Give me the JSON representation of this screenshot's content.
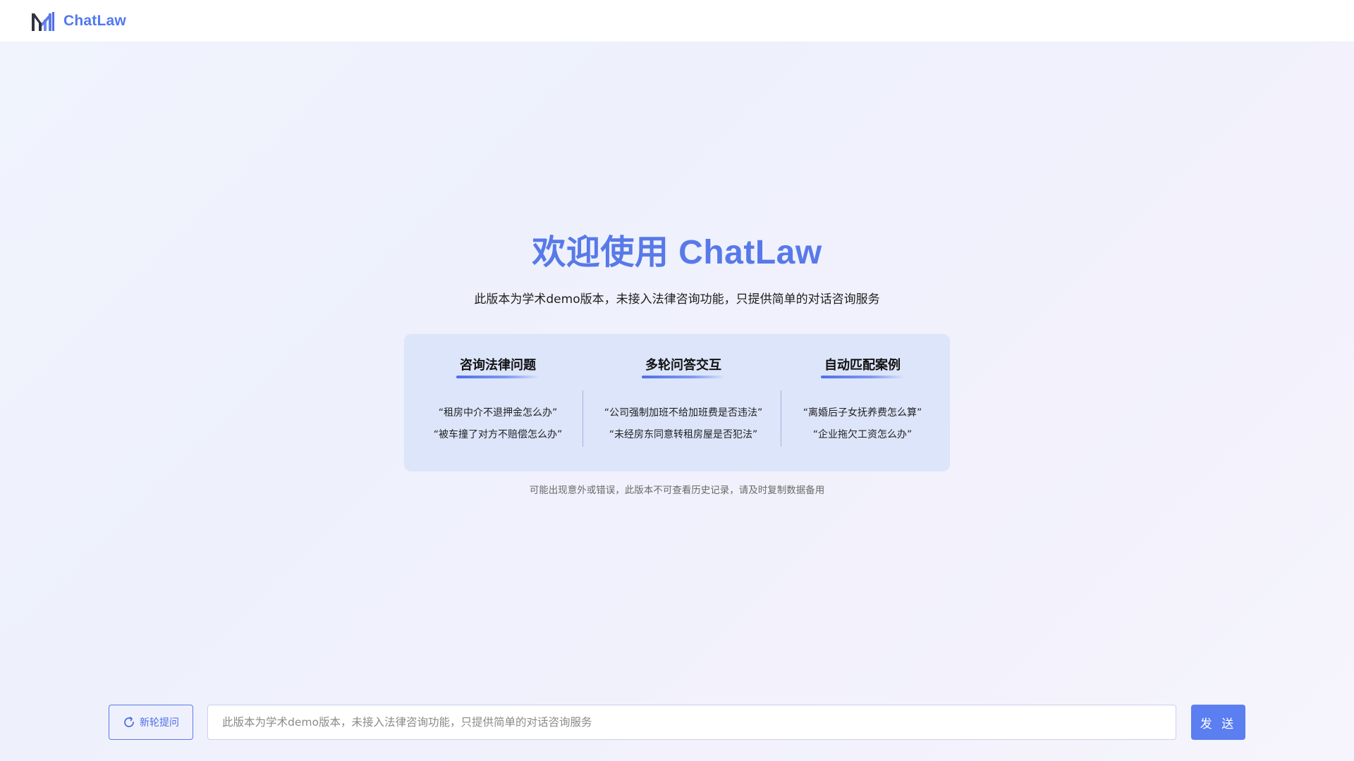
{
  "header": {
    "logo_icon": "bar-chart-logo-icon",
    "brand": "ChatLaw"
  },
  "hero": {
    "title": "欢迎使用 ChatLaw",
    "subtitle": "此版本为学术demo版本，未接入法律咨询功能，只提供简单的对话咨询服务"
  },
  "features": [
    {
      "title": "咨询法律问题",
      "examples": [
        "“租房中介不退押金怎么办”",
        "“被车撞了对方不赔偿怎么办”"
      ]
    },
    {
      "title": "多轮问答交互",
      "examples": [
        "“公司强制加班不给加班费是否违法”",
        "“未经房东同意转租房屋是否犯法”"
      ]
    },
    {
      "title": "自动匹配案例",
      "examples": [
        "“离婚后子女抚养费怎么算”",
        "“企业拖欠工资怎么办”"
      ]
    }
  ],
  "disclaimer": "可能出现意外或错误，此版本不可查看历史记录，请及时复制数据备用",
  "input_bar": {
    "new_round_label": "新轮提问",
    "new_round_icon": "refresh-icon",
    "placeholder": "此版本为学术demo版本，未接入法律咨询功能，只提供简单的对话咨询服务",
    "value": "",
    "send_label": "发 送"
  },
  "colors": {
    "accent": "#5b7ef1",
    "brand": "#4f79f1",
    "title": "#5879e8",
    "panel": "#d6e0fa"
  }
}
